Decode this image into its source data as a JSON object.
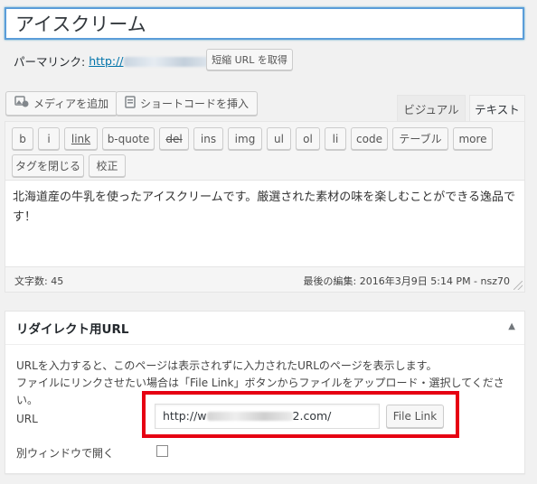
{
  "post": {
    "title": "アイスクリーム",
    "permalink_label": "パーマリンク:",
    "permalink_prefix": "http://",
    "shortlink_button": "短縮 URL を取得"
  },
  "media_buttons": {
    "add_media": "メディアを追加",
    "insert_shortcode": "ショートコードを挿入"
  },
  "editor_tabs": {
    "visual": "ビジュアル",
    "text": "テキスト",
    "active": "text"
  },
  "quicktags": [
    "b",
    "i",
    "link",
    "b-quote",
    "del",
    "ins",
    "img",
    "ul",
    "ol",
    "li",
    "code",
    "テーブル",
    "more",
    "タグを閉じる",
    "校正"
  ],
  "editor": {
    "content": "北海道産の牛乳を使ったアイスクリームです。厳選された素材の味を楽しむことができる逸品です！",
    "word_count": "文字数: 45",
    "last_edited": "最後の編集: 2016年3月9日 5:14 PM - nsz70"
  },
  "redirect_box": {
    "title": "リダイレクト用URL",
    "description_line1": "URLを入力すると、このページは表示されずに入力されたURLのページを表示します。",
    "description_line2": "ファイルにリンクさせたい場合は「File Link」ボタンからファイルをアップロード・選択してください。",
    "url_label": "URL",
    "url_prefix": "http://w",
    "url_suffix": "2.com/",
    "file_link_button": "File Link",
    "open_new_window_label": "別ウィンドウで開く",
    "open_new_window_checked": false
  },
  "colors": {
    "focus_border": "#5b9dd9",
    "link": "#0073aa",
    "highlight_box": "#e60012"
  }
}
